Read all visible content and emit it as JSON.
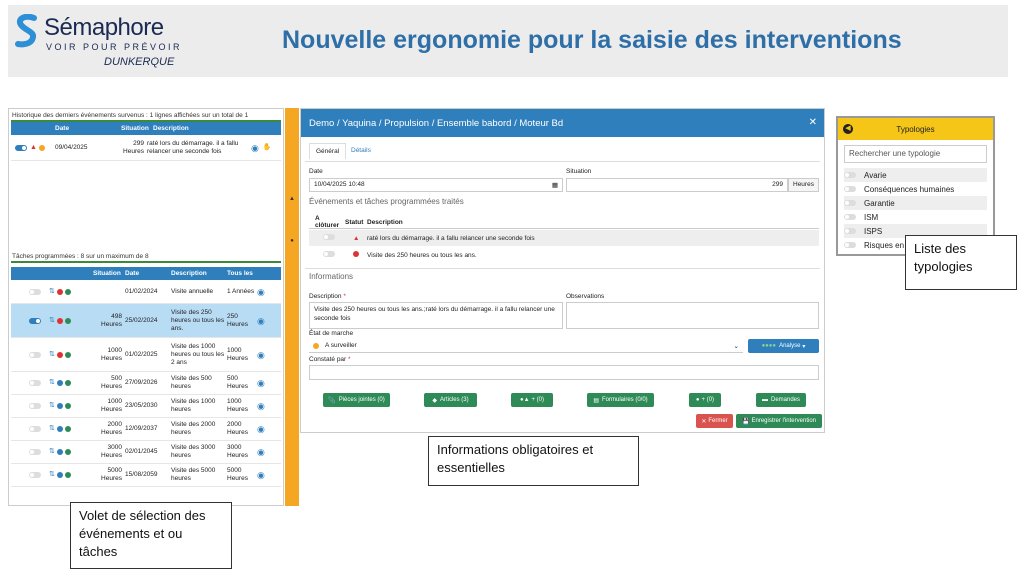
{
  "header": {
    "brand": "Sémaphore",
    "tagline": "VOIR POUR PRÉVOIR",
    "city": "DUNKERQUE",
    "title": "Nouvelle ergonomie pour la saisie des interventions"
  },
  "history": {
    "title": "Historique des derniers événements survenus : 1 lignes affichées sur un total de 1",
    "columns": [
      "Date",
      "Situation",
      "Description"
    ],
    "rows": [
      {
        "date": "09/04/2025",
        "situation": "299 Heures",
        "description": "raté lors du démarrage. il a fallu relancer une seconde fois"
      }
    ]
  },
  "tasks": {
    "title": "Tâches programmées : 8 sur un maximum de 8",
    "columns": [
      "Situation",
      "Date",
      "Description",
      "Tous les"
    ],
    "rows": [
      {
        "situation": "",
        "date": "01/02/2024",
        "description": "Visite annuelle",
        "every": "1 Années"
      },
      {
        "situation": "498 Heures",
        "date": "25/02/2024",
        "description": "Visite des 250 heures ou tous les ans.",
        "every": "250 Heures"
      },
      {
        "situation": "1000 Heures",
        "date": "01/02/2025",
        "description": "Visite des 1000 heures ou tous les 2 ans",
        "every": "1000 Heures"
      },
      {
        "situation": "500 Heures",
        "date": "27/09/2026",
        "description": "Visite des 500 heures",
        "every": "500 Heures"
      },
      {
        "situation": "1000 Heures",
        "date": "23/05/2030",
        "description": "Visite des 1000 heures",
        "every": "1000 Heures"
      },
      {
        "situation": "2000 Heures",
        "date": "12/09/2037",
        "description": "Visite des 2000 heures",
        "every": "2000 Heures"
      },
      {
        "situation": "3000 Heures",
        "date": "02/01/2045",
        "description": "Visite des 3000 heures",
        "every": "3000 Heures"
      },
      {
        "situation": "5000 Heures",
        "date": "15/08/2059",
        "description": "Visite des 5000 heures",
        "every": "5000 Heures"
      }
    ]
  },
  "form": {
    "breadcrumb": "Demo / Yaquina / Propulsion / Ensemble babord / Moteur Bd",
    "tabs": [
      "Général",
      "Détails"
    ],
    "date_label": "Date",
    "date_value": "10/04/2025 10:48",
    "situation_label": "Situation",
    "situation_value": "299",
    "situation_unit": "Heures",
    "events_title": "Événements et tâches programmées traités",
    "events_columns": [
      "A clôturer",
      "Statut",
      "Description"
    ],
    "events": [
      {
        "description": "raté lors du démarrage. il a fallu relancer une seconde fois"
      },
      {
        "description": "Visite des 250 heures ou tous les ans."
      }
    ],
    "info_title": "Informations",
    "description_label": "Description",
    "description_value": "Visite des 250 heures ou tous les ans.;raté lors du démarrage. il a fallu relancer une seconde fois",
    "observations_label": "Observations",
    "etat_label": "État de marche",
    "etat_value": "A surveiller",
    "analyse_label": "Analyse",
    "constate_label": "Constaté par",
    "buttons": [
      "Pièces jointes (0)",
      "Articles (3)",
      "+ (0)",
      "Formulaires (0/0)",
      "+ (0)",
      "Demandes"
    ],
    "close_label": "Fermer",
    "save_label": "Enregistrer l'intervention"
  },
  "typologies": {
    "title": "Typologies",
    "search_placeholder": "Rechercher une typologie",
    "items": [
      "Avarie",
      "Conséquences humaines",
      "Garantie",
      "ISM",
      "ISPS",
      "Risques en"
    ]
  },
  "callouts": {
    "typologies": "Liste des typologies",
    "info": "Informations obligatoires et essentielles",
    "volet": "Volet de sélection des événements et ou tâches"
  },
  "colors": {
    "accent": "#2f7fbd",
    "green": "#2e8b57",
    "orange": "#f5a623",
    "yellow": "#f5c518",
    "title": "#2e6fa8"
  }
}
